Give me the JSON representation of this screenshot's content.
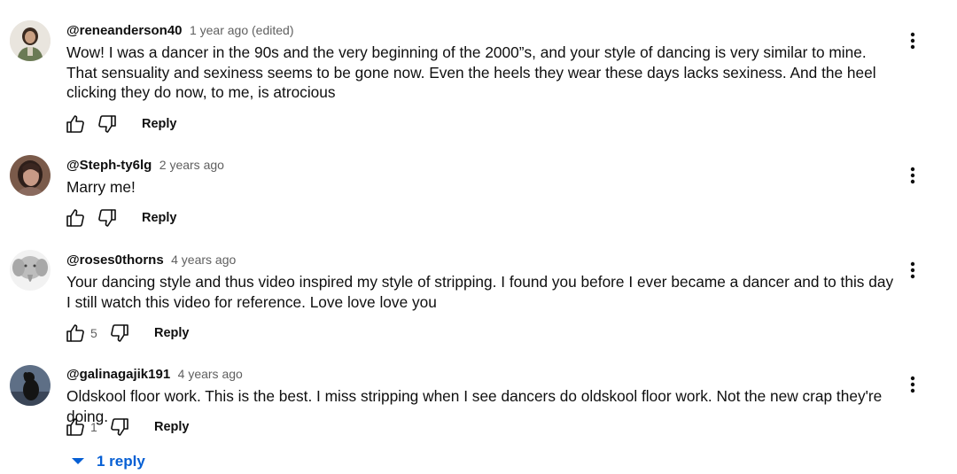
{
  "comments": [
    {
      "author": "@reneanderson40",
      "time": "1 year ago (edited)",
      "text": "Wow! I was a dancer in the 90s and the very beginning of the 2000”s, and your style of dancing is very similar to mine. That sensuality and sexiness seems to be gone now. Even the heels they wear these days lacks sexiness. And the heel clicking they do now, to me, is atrocious",
      "likes": "",
      "reply_label": "Reply",
      "avatar_icon": "person-avatar-icon"
    },
    {
      "author": "@Steph-ty6lg",
      "time": "2 years ago",
      "text": "Marry me!",
      "likes": "",
      "reply_label": "Reply",
      "avatar_icon": "person-avatar-icon"
    },
    {
      "author": "@roses0thorns",
      "time": "4 years ago",
      "text": "Your dancing style and thus video inspired my style of stripping. I found you before I ever became a dancer and to this day I still watch this video for reference. Love love love you",
      "likes": "5",
      "reply_label": "Reply",
      "avatar_icon": "elephant-avatar-icon"
    },
    {
      "author": "@galinagajik191",
      "time": "4 years ago",
      "text": "Oldskool floor work. This is the best. I miss stripping when I see dancers do oldskool floor work. Not the new crap they're doing.",
      "likes": "1",
      "reply_label": "Reply",
      "avatar_icon": "dog-avatar-icon"
    }
  ],
  "replies_toggle": {
    "label": "1 reply",
    "icon": "caret-down-icon"
  },
  "colors": {
    "text": "#0f0f0f",
    "meta": "#606060",
    "link": "#065fd4",
    "background": "#ffffff"
  }
}
